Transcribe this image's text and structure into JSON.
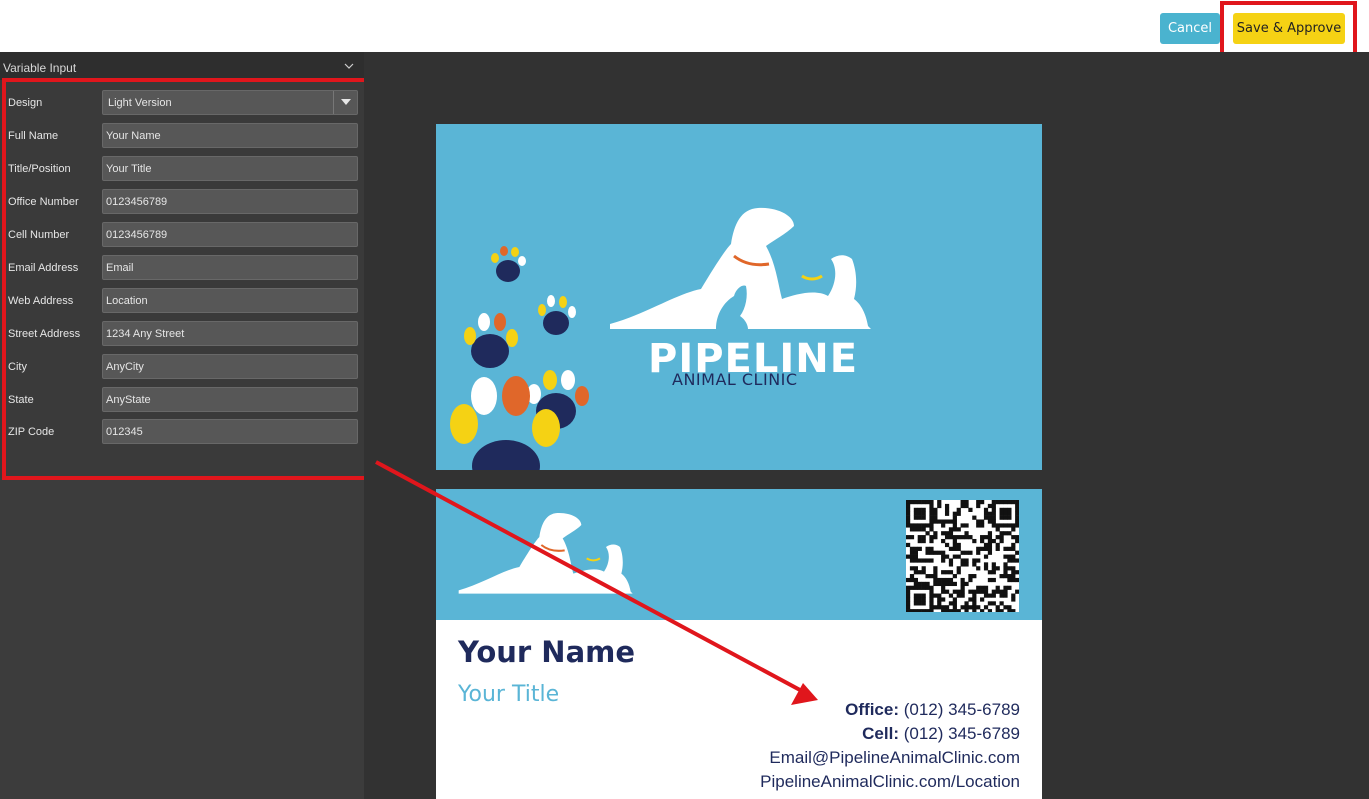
{
  "toolbar": {
    "cancel_label": "Cancel",
    "save_label": "Save & Approve"
  },
  "panel": {
    "title": "Variable Input",
    "fields": [
      {
        "label": "Design",
        "value": "Light Version",
        "type": "select"
      },
      {
        "label": "Full Name",
        "value": "Your Name"
      },
      {
        "label": "Title/Position",
        "value": "Your Title"
      },
      {
        "label": "Office Number",
        "value": "0123456789"
      },
      {
        "label": "Cell Number",
        "value": "0123456789"
      },
      {
        "label": "Email Address",
        "value": "Email"
      },
      {
        "label": "Web Address",
        "value": "Location"
      },
      {
        "label": "Street Address",
        "value": "1234 Any Street"
      },
      {
        "label": "City",
        "value": "AnyCity"
      },
      {
        "label": "State",
        "value": "AnyState"
      },
      {
        "label": "ZIP Code",
        "value": "012345"
      }
    ]
  },
  "card": {
    "logo_main": "PIPELINE",
    "logo_sub": "ANIMAL CLINIC",
    "name": "Your Name",
    "title": "Your Title",
    "office_label": "Office:",
    "office_value": "(012) 345-6789",
    "cell_label": "Cell:",
    "cell_value": "(012) 345-6789",
    "email": "Email@PipelineAnimalClinic.com",
    "web": "PipelineAnimalClinic.com/Location"
  },
  "colors": {
    "brand_blue": "#5ab5d6",
    "brand_navy": "#1f2a5c",
    "accent_yellow": "#f5d214",
    "highlight_red": "#e0161c",
    "paw_orange": "#e0672a"
  }
}
